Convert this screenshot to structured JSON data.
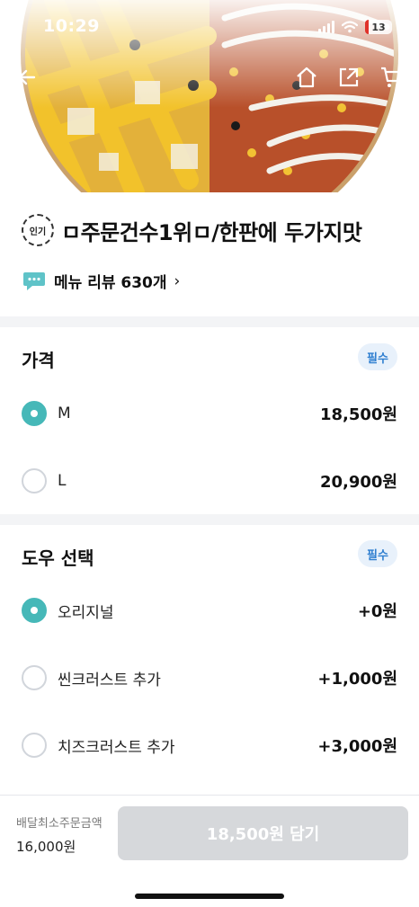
{
  "status_bar": {
    "time": "10:29",
    "battery": "13"
  },
  "nav": {
    "back_icon": "arrow-left-icon",
    "home_icon": "home-icon",
    "share_icon": "share-icon",
    "cart_icon": "cart-icon"
  },
  "menu": {
    "badge": "인기",
    "title": "ㅁ주문건수1위ㅁ/한판에 두가지맛",
    "review_label": "메뉴 리뷰 630개",
    "review_chevron": "›"
  },
  "price_group": {
    "title": "가격",
    "required": "필수",
    "options": [
      {
        "label": "M",
        "price": "18,500원",
        "selected": true
      },
      {
        "label": "L",
        "price": "20,900원",
        "selected": false
      }
    ]
  },
  "dough_group": {
    "title": "도우 선택",
    "required": "필수",
    "options": [
      {
        "label": "오리지널",
        "price": "+0원",
        "selected": true
      },
      {
        "label": "씬크러스트 추가",
        "price": "+1,000원",
        "selected": false
      },
      {
        "label": "치즈크러스트 추가",
        "price": "+3,000원",
        "selected": false
      }
    ]
  },
  "bottom": {
    "min_order_label": "배달최소주문금액",
    "min_order_value": "16,000원",
    "cart_button": "18,500원 담기"
  },
  "colors": {
    "accent": "#46b8b8",
    "badge_bg": "#e8f1fb",
    "badge_text": "#2f7fd0",
    "button_disabled": "#d6d8db"
  }
}
